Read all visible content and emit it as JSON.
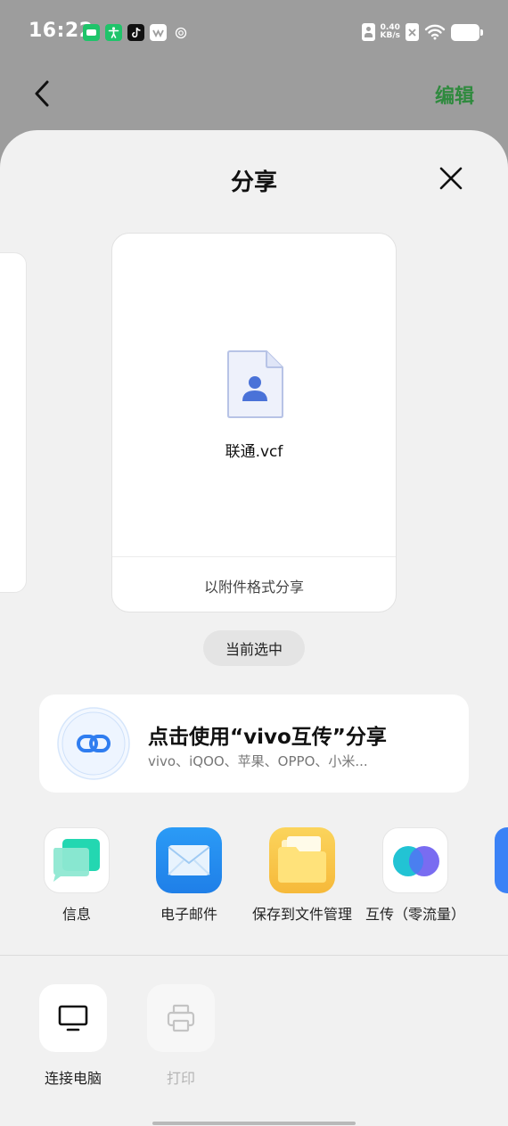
{
  "status_bar": {
    "time": "16:22",
    "net_speed_value": "0.40",
    "net_speed_unit": "KB/s",
    "app_icons": [
      "chat-app-icon",
      "accessibility-icon",
      "tiktok-icon",
      "bilibili-icon",
      "copyright-icon"
    ]
  },
  "top_bar": {
    "edit_label": "编辑",
    "accent": "#2f8a3e"
  },
  "sheet": {
    "title": "分享",
    "preview": {
      "file_name": "联通.vcf",
      "footer": "以附件格式分享"
    },
    "current_pill": "当前选中",
    "vivo_share": {
      "title": "点击使用“vivo互传”分享",
      "subtitle": "vivo、iQOO、苹果、OPPO、小米..."
    },
    "apps": [
      {
        "label": "信息",
        "icon": "messages-icon"
      },
      {
        "label": "电子邮件",
        "icon": "email-icon"
      },
      {
        "label": "保存到文件管理",
        "icon": "folder-icon"
      },
      {
        "label": "互传（零流量）",
        "icon": "vivo-share-icon"
      }
    ],
    "tools": [
      {
        "label": "连接电脑",
        "icon": "monitor-icon",
        "enabled": true
      },
      {
        "label": "打印",
        "icon": "printer-icon",
        "enabled": false
      }
    ]
  }
}
